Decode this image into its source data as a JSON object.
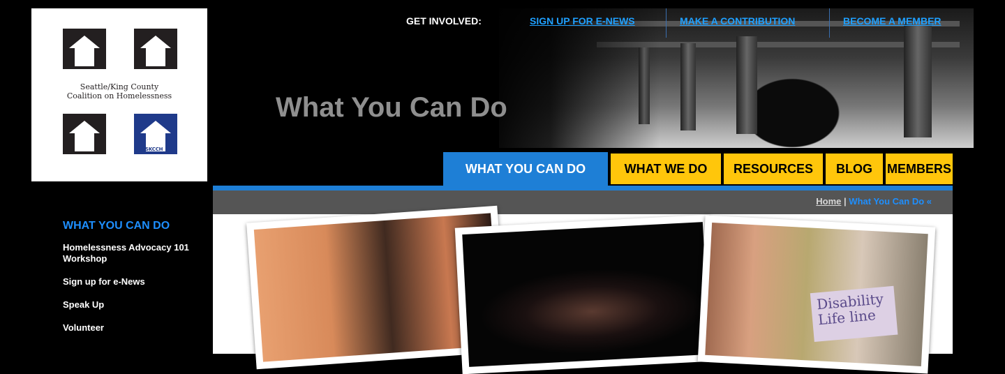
{
  "logo": {
    "text_line1": "Seattle/King County",
    "text_line2": "Coalition on Homelessness",
    "badge": "SKCCH"
  },
  "topbar": {
    "label": "GET INVOLVED:",
    "links": [
      "SIGN UP FOR E-NEWS",
      "MAKE A CONTRIBUTION",
      "BECOME A MEMBER"
    ]
  },
  "hero": {
    "title": "What You Can Do"
  },
  "nav": {
    "tabs": [
      "WHAT YOU CAN DO",
      "WHAT WE DO",
      "RESOURCES",
      "BLOG",
      "MEMBERS"
    ],
    "active_color": "#1e7fd6",
    "tab_color": "#ffc60b"
  },
  "breadcrumb": {
    "home": "Home",
    "separator": "|",
    "current": "What You Can Do «"
  },
  "sidebar": {
    "title": "WHAT YOU CAN DO",
    "items": [
      "Homelessness Advocacy 101 Workshop",
      "Sign up for e-News",
      "Speak Up",
      "Volunteer"
    ]
  },
  "photos": {
    "sign_text": "Disability Life line"
  }
}
